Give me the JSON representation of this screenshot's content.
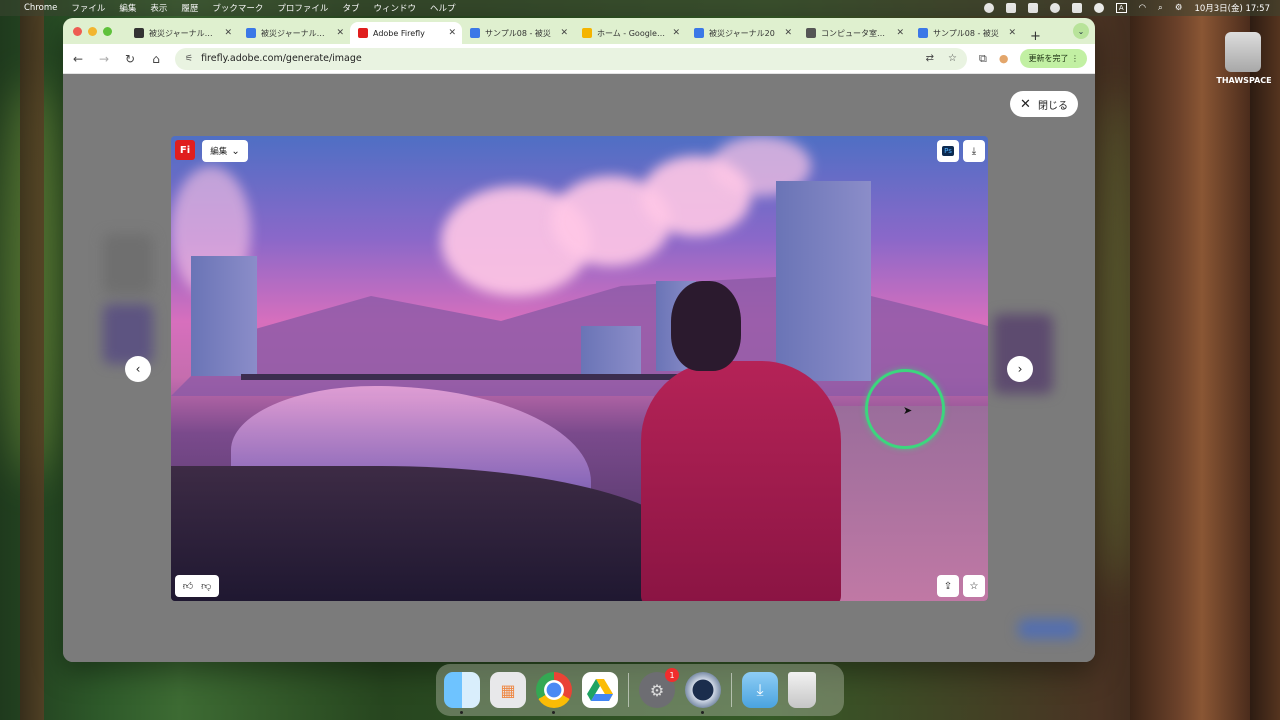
{
  "menubar": {
    "app": "Chrome",
    "items": [
      "ファイル",
      "編集",
      "表示",
      "履歴",
      "ブックマーク",
      "プロファイル",
      "タブ",
      "ウィンドウ",
      "ヘルプ"
    ],
    "clock": "10月3日(金) 17:57",
    "input_indicator": "A"
  },
  "tabs": [
    {
      "title": "被災ジャーナル用画",
      "fav_color": "#333333"
    },
    {
      "title": "被災ジャーナル画像",
      "fav_color": "#3b78e7"
    },
    {
      "title": "Adobe Firefly",
      "fav_color": "#e01e1e"
    },
    {
      "title": "サンプル08 - 被災",
      "fav_color": "#3b78e7"
    },
    {
      "title": "ホーム - Google ドラ",
      "fav_color": "#f4b400"
    },
    {
      "title": "被災ジャーナル20",
      "fav_color": "#3b78e7"
    },
    {
      "title": "コンピュータ室への",
      "fav_color": "#555555"
    },
    {
      "title": "サンプル08 - 被災",
      "fav_color": "#3b78e7"
    }
  ],
  "toolbar": {
    "url": "firefly.adobe.com/generate/image",
    "update_label": "更新を完了"
  },
  "viewer": {
    "close_label": "閉じる",
    "edit_label": "編集",
    "logo_text": "Fi",
    "ps_label": "Ps"
  },
  "desktop": {
    "drive_label": "THAWSPACE"
  },
  "dock": {
    "settings_badge": "1"
  }
}
